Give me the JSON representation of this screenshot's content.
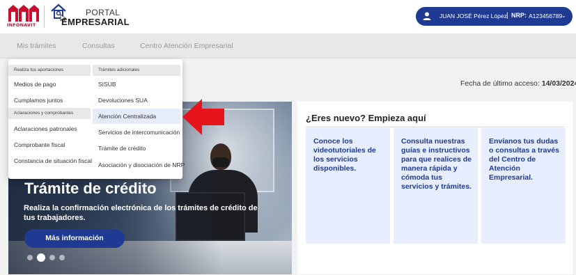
{
  "header": {
    "logo_text": "INFONAVIT",
    "portal_line1": "PORTAL",
    "portal_line2": "EMPRESARIAL",
    "user_name": "JUAN JOSÉ Pérez López",
    "separator": "|",
    "nrp_label": "NRP:",
    "nrp_value": "A123456789",
    "chevron": "⌄"
  },
  "nav": {
    "items": [
      {
        "label": "Mis trámites"
      },
      {
        "label": "Consultas"
      },
      {
        "label": "Centro Atención Empresarial"
      }
    ]
  },
  "dropdown": {
    "col1_header": "Realiza tus aportaciones",
    "col1_items": [
      "Medios de pago",
      "Cumplamos juntos"
    ],
    "col1_header2": "Aclaraciones y comprobantes",
    "col1_items2": [
      "Aclaraciones patronales",
      "Comprobante fiscal",
      "Constancia de situación fiscal"
    ],
    "col2_header": "Trámites adicionales",
    "col2_items": [
      "SISUB",
      "Devoluciones SUA",
      "Atención Centralizada",
      "Servicios de intercomunicación",
      "Trámite de crédito",
      "Asociación y disociación de NRP"
    ]
  },
  "last_access": {
    "label": "Fecha de último acceso:",
    "value": "14/03/2024"
  },
  "hero": {
    "title": "Trámite de crédito",
    "subtitle": "Realiza la confirmación electrónica de los trámites de crédito de tus trabajadores.",
    "button_label": "Más información"
  },
  "new_panel": {
    "title": "¿Eres nuevo? Empieza aquí",
    "cards": [
      {
        "text": "Conoce los videotutoriales de los servicios disponibles."
      },
      {
        "text": "Consulta nuestras guías e instructivos para que realices de manera rápida y cómoda tus servicios y trámites."
      },
      {
        "text": "Envíanos tus dudas o consultas a través del Centro de Atención Empresarial."
      }
    ]
  },
  "colors": {
    "brand_red": "#c8102e",
    "brand_blue": "#1f3a93",
    "card_bg": "#e6eeff",
    "highlight": "#e6ecfa",
    "arrow_red": "#e8141b"
  },
  "icons": {
    "infonavit_logo": "infonavit-house-logo",
    "portal_logo": "house-cursor-icon",
    "user_avatar": "user-icon",
    "arrow": "red-arrow-pointer"
  }
}
